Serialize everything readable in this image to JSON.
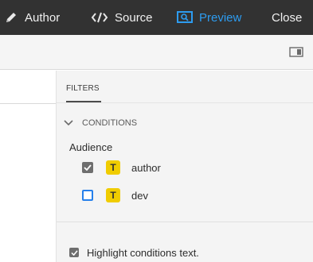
{
  "topbar": {
    "author": {
      "label": "Author",
      "icon": "pencil-icon"
    },
    "source": {
      "label": "Source",
      "icon": "code-icon"
    },
    "preview": {
      "label": "Preview",
      "icon": "preview-icon",
      "active": true,
      "color": "#2d9cf0"
    },
    "close": {
      "label": "Close"
    }
  },
  "toolbar": {
    "panel_toggle_icon": "panel-toggle-icon"
  },
  "filters_panel": {
    "tab_label": "FILTERS",
    "conditions": {
      "header": "CONDITIONS",
      "expanded": true,
      "group_label": "Audience",
      "items": [
        {
          "tag": "T",
          "label": "author",
          "checked": true
        },
        {
          "tag": "T",
          "label": "dev",
          "checked": false
        }
      ]
    },
    "highlight": {
      "label": "Highlight conditions text.",
      "checked": true
    }
  },
  "colors": {
    "topbar_bg": "#323232",
    "accent": "#2d9cf0",
    "tag_yellow": "#f0cc00",
    "checkbox_blue": "#2680eb"
  }
}
